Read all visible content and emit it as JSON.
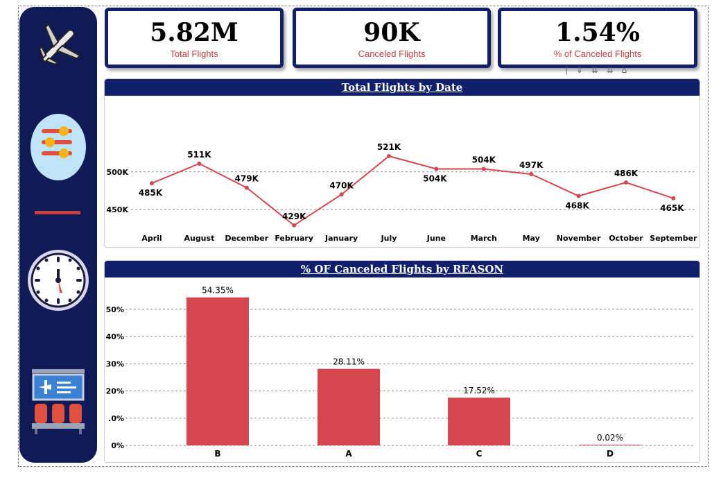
{
  "kpis": [
    {
      "value": "5.82M",
      "label": "Total Flights"
    },
    {
      "value": "90K",
      "label": "Canceled Flights"
    },
    {
      "value": "1.54%",
      "label": "% of Canceled Flights"
    }
  ],
  "toolbar_glyphs": "| ⇓ ⇊ ⇊ ⌂",
  "colors": {
    "navy": "#12206b",
    "accent": "#d6464f",
    "label_red": "#c6403f"
  },
  "sidebar": {
    "icons": [
      "airplane-icon",
      "filter-sliders-icon",
      "divider-line",
      "clock-icon",
      "departure-board-icon"
    ]
  },
  "chart_data": [
    {
      "type": "line",
      "title": "Total Flights by Date",
      "categories": [
        "April",
        "August",
        "December",
        "February",
        "January",
        "July",
        "June",
        "March",
        "May",
        "November",
        "October",
        "September"
      ],
      "values": [
        485,
        511,
        479,
        429,
        470,
        521,
        504,
        504,
        497,
        468,
        486,
        465
      ],
      "data_labels": [
        "485K",
        "511K",
        "479K",
        "429K",
        "470K",
        "521K",
        "504K",
        "504K",
        "497K",
        "468K",
        "486K",
        "465K"
      ],
      "y_ticks": [
        "500K",
        "450K"
      ],
      "ylim": [
        415,
        545
      ],
      "grid": true
    },
    {
      "type": "bar",
      "title": "% OF Canceled Flights by REASON",
      "categories": [
        "B",
        "A",
        "C",
        "D"
      ],
      "values": [
        54.35,
        28.11,
        17.52,
        0.02
      ],
      "data_labels": [
        "54.35%",
        "28.11%",
        "17.52%",
        "0.02%"
      ],
      "y_ticks": [
        "0%",
        ".0%",
        "20%",
        "30%",
        "40%",
        "50%"
      ],
      "ylim": [
        0,
        60
      ],
      "grid": true
    }
  ]
}
